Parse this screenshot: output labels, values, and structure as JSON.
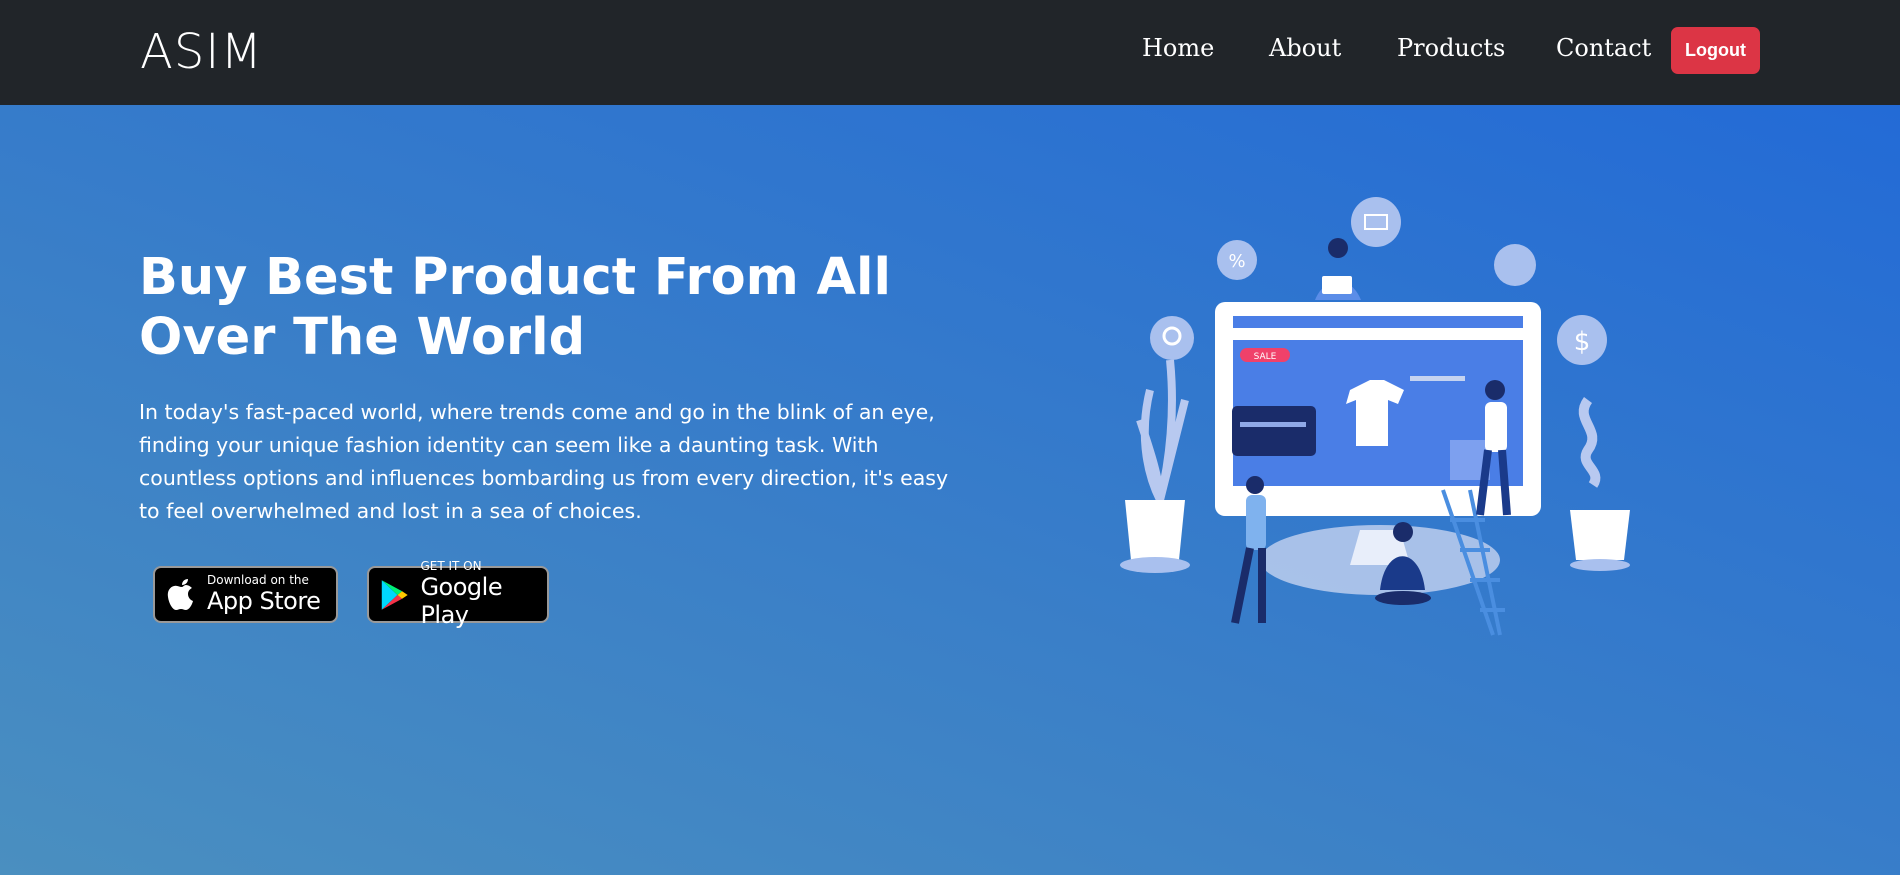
{
  "navbar": {
    "brand": "ASIM",
    "links": [
      "Home",
      "About",
      "Products",
      "Contact"
    ],
    "logout": "Logout"
  },
  "hero": {
    "title": "Buy Best Product From All Over The World",
    "paragraph": "In today's fast-paced world, where trends come and go in the blink of an eye, finding your unique fashion identity can seem like a daunting task. With countless options and influences bombarding us from every direction, it's easy to feel overwhelmed and lost in a sea of choices.",
    "app_store": {
      "small": "Download on the",
      "big": "App Store"
    },
    "google_play": {
      "small": "GET IT ON",
      "big": "Google Play"
    },
    "illustration": {
      "sale_label": "SALE",
      "percent_symbol": "%",
      "dollar_symbol": "$"
    }
  },
  "colors": {
    "navbar": "#212529",
    "logout": "#dc3545"
  }
}
